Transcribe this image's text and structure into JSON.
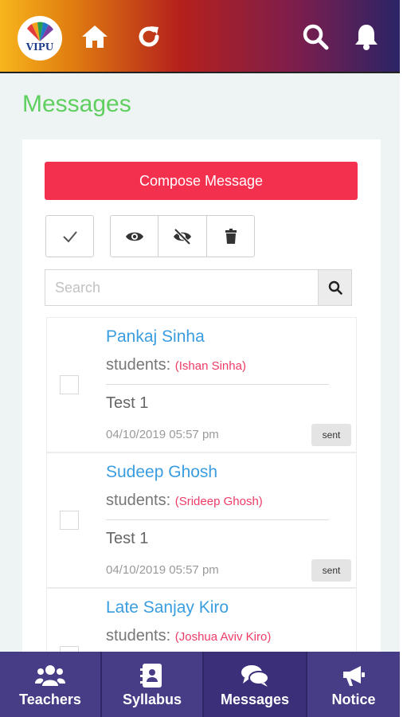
{
  "header": {
    "logo_text": "VIPU",
    "icons": [
      "home-icon",
      "refresh-icon",
      "search-icon",
      "bell-icon"
    ],
    "gradient_colors": [
      "#f7b51d",
      "#b5201c",
      "#2a2466"
    ]
  },
  "page": {
    "title": "Messages",
    "title_color": "#5fcf5f"
  },
  "compose": {
    "label": "Compose Message",
    "color": "#f4304f"
  },
  "toolbar": {
    "icons": [
      "check-icon",
      "eye-icon",
      "eye-slash-icon",
      "trash-icon"
    ]
  },
  "search": {
    "placeholder": "Search",
    "value": ""
  },
  "messages": [
    {
      "sender": "Pankaj Sinha",
      "students_label": "students:",
      "students": "(Ishan Sinha)",
      "subject": "Test 1",
      "date": "04/10/2019 05:57 pm",
      "status": "sent"
    },
    {
      "sender": "Sudeep Ghosh",
      "students_label": "students:",
      "students": "(Srideep Ghosh)",
      "subject": "Test 1",
      "date": "04/10/2019 05:57 pm",
      "status": "sent"
    },
    {
      "sender": "Late Sanjay Kiro",
      "students_label": "students:",
      "students": "(Joshua Aviv Kiro)",
      "subject": "",
      "date": "",
      "status": ""
    }
  ],
  "bottom_nav": [
    {
      "label": "Teachers",
      "icon": "users-icon",
      "active": false
    },
    {
      "label": "Syllabus",
      "icon": "address-book-icon",
      "active": false
    },
    {
      "label": "Messages",
      "icon": "comments-icon",
      "active": true
    },
    {
      "label": "Notice",
      "icon": "bullhorn-icon",
      "active": false
    }
  ],
  "colors": {
    "accent_blue": "#3a9ddf",
    "student_pink": "#ee3b66",
    "nav_bg": "#473c86"
  }
}
